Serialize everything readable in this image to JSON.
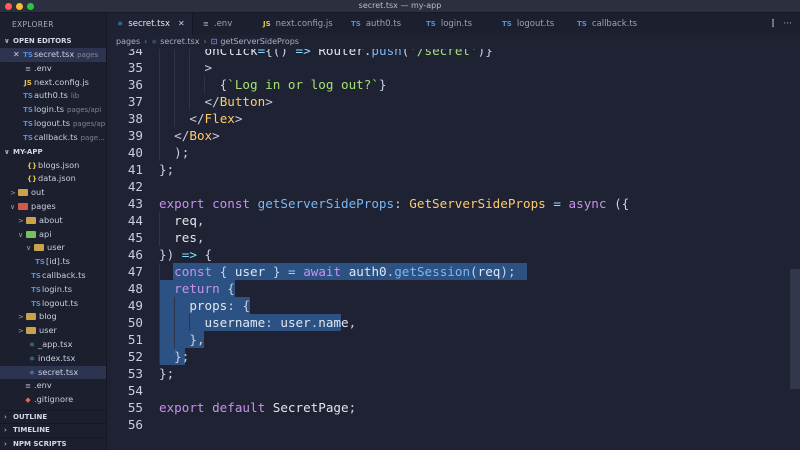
{
  "window": {
    "title": "secret.tsx — my-app"
  },
  "sidebar": {
    "title": "EXPLORER",
    "open_editors_label": "OPEN EDITORS",
    "open_editors": [
      {
        "icon": "TS",
        "name": "secret.tsx",
        "detail": "pages"
      },
      {
        "icon": "≡",
        "name": ".env",
        "detail": ""
      },
      {
        "icon": "JS",
        "name": "next.config.js",
        "detail": ""
      },
      {
        "icon": "TS",
        "name": "auth0.ts",
        "detail": "lib"
      },
      {
        "icon": "TS",
        "name": "login.ts",
        "detail": "pages/api"
      },
      {
        "icon": "TS",
        "name": "logout.ts",
        "detail": "pages/api"
      },
      {
        "icon": "TS",
        "name": "callback.ts",
        "detail": "page..."
      }
    ],
    "project_label": "MY-APP",
    "tree": [
      {
        "icon": "{}",
        "name": "blogs.json"
      },
      {
        "icon": "{}",
        "name": "data.json"
      },
      {
        "icon": ">",
        "name": "out"
      },
      {
        "icon": "∨",
        "name": "pages"
      },
      {
        "icon": ">",
        "name": "about"
      },
      {
        "icon": "∨",
        "name": "api"
      },
      {
        "icon": "∨",
        "name": "user"
      },
      {
        "icon": "TS",
        "name": "[id].ts"
      },
      {
        "icon": "TS",
        "name": "callback.ts"
      },
      {
        "icon": "TS",
        "name": "login.ts"
      },
      {
        "icon": "TS",
        "name": "logout.ts"
      },
      {
        "icon": ">",
        "name": "blog"
      },
      {
        "icon": ">",
        "name": "user"
      },
      {
        "icon": "⚛",
        "name": "_app.tsx"
      },
      {
        "icon": "⚛",
        "name": "index.tsx"
      },
      {
        "icon": "⚛",
        "name": "secret.tsx"
      },
      {
        "icon": "≡",
        "name": ".env"
      },
      {
        "icon": "◆",
        "name": ".gitignore"
      }
    ],
    "bottom_sections": [
      "OUTLINE",
      "TIMELINE",
      "NPM SCRIPTS"
    ]
  },
  "tabs": [
    {
      "icon": "⚛",
      "label": "secret.tsx",
      "close": "✕"
    },
    {
      "icon": "≡",
      "label": ".env"
    },
    {
      "icon": "JS",
      "label": "next.config.js"
    },
    {
      "icon": "TS",
      "label": "auth0.ts"
    },
    {
      "icon": "TS",
      "label": "login.ts"
    },
    {
      "icon": "TS",
      "label": "logout.ts"
    },
    {
      "icon": "TS",
      "label": "callback.ts"
    }
  ],
  "tab_actions": {
    "split": "⫿",
    "more": "···"
  },
  "breadcrumb": {
    "folder": "pages",
    "file": "secret.tsx",
    "symbol": "getServerSideProps"
  },
  "editor": {
    "lines": [
      {
        "n": "34",
        "text": "      onClick={() => Router.push('/secret')}"
      },
      {
        "n": "35",
        "text": "      >"
      },
      {
        "n": "36",
        "text": "        {`Log in or log out?`}"
      },
      {
        "n": "37",
        "text": "      </Button>"
      },
      {
        "n": "38",
        "text": "    </Flex>"
      },
      {
        "n": "39",
        "text": "  </Box>"
      },
      {
        "n": "40",
        "text": "  );"
      },
      {
        "n": "41",
        "text": "};"
      },
      {
        "n": "42",
        "text": ""
      },
      {
        "n": "43",
        "text": "export const getServerSideProps: GetServerSideProps = async ({"
      },
      {
        "n": "44",
        "text": "  req,"
      },
      {
        "n": "45",
        "text": "  res,"
      },
      {
        "n": "46",
        "text": "}) => {"
      },
      {
        "n": "47",
        "text": "  const { user } = await auth0.getSession(req);"
      },
      {
        "n": "48",
        "text": "  return {"
      },
      {
        "n": "49",
        "text": "    props: {"
      },
      {
        "n": "50",
        "text": "      username: user.name,"
      },
      {
        "n": "51",
        "text": "    },"
      },
      {
        "n": "52",
        "text": "  };"
      },
      {
        "n": "53",
        "text": "};"
      },
      {
        "n": "54",
        "text": ""
      },
      {
        "n": "55",
        "text": "export default SecretPage;"
      },
      {
        "n": "56",
        "text": ""
      }
    ]
  },
  "colors": {
    "selection": "#2b5283",
    "keyword": "#c792ea",
    "function": "#7bb8f5",
    "type": "#ffcb6b",
    "string": "#a5e075"
  }
}
